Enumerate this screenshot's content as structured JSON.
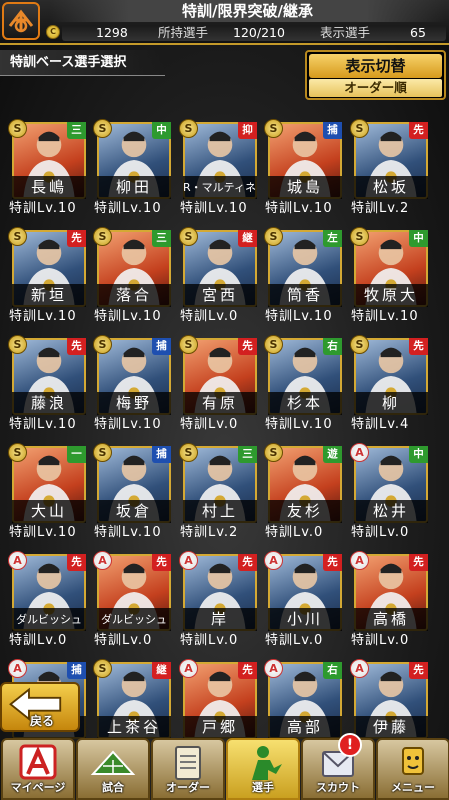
{
  "header": {
    "title": "特訓/限界突破/継承",
    "coin_value": "1298",
    "players_label": "所持選手",
    "players_value": "120/210",
    "display_label": "表示選手",
    "display_value": "65"
  },
  "subheader": {
    "title": "特訓ベース選手選択"
  },
  "display_toggle": {
    "label": "表示切替",
    "sort": "オーダー順"
  },
  "cards": [
    {
      "name": "長嶋",
      "pos": "三",
      "pos_color": "green",
      "emblem": "S",
      "level": "特訓Lv.10"
    },
    {
      "name": "柳田",
      "pos": "中",
      "pos_color": "green",
      "emblem": "S",
      "level": "特訓Lv.10"
    },
    {
      "name": "R・マルティネス",
      "pos": "抑",
      "pos_color": "red",
      "emblem": "S",
      "level": "特訓Lv.10"
    },
    {
      "name": "城島",
      "pos": "捕",
      "pos_color": "navy",
      "emblem": "S",
      "level": "特訓Lv.10"
    },
    {
      "name": "松坂",
      "pos": "先",
      "pos_color": "red",
      "emblem": "S",
      "level": "特訓Lv.2"
    },
    {
      "name": "新垣",
      "pos": "先",
      "pos_color": "red",
      "emblem": "S",
      "level": "特訓Lv.10"
    },
    {
      "name": "落合",
      "pos": "三",
      "pos_color": "green",
      "emblem": "S",
      "level": "特訓Lv.10"
    },
    {
      "name": "宮西",
      "pos": "継",
      "pos_color": "red",
      "emblem": "S",
      "level": "特訓Lv.0"
    },
    {
      "name": "筒香",
      "pos": "左",
      "pos_color": "green",
      "emblem": "S",
      "level": "特訓Lv.10"
    },
    {
      "name": "牧原大",
      "pos": "中",
      "pos_color": "green",
      "emblem": "S",
      "level": "特訓Lv.10"
    },
    {
      "name": "藤浪",
      "pos": "先",
      "pos_color": "red",
      "emblem": "S",
      "level": "特訓Lv.10"
    },
    {
      "name": "梅野",
      "pos": "捕",
      "pos_color": "navy",
      "emblem": "S",
      "level": "特訓Lv.10"
    },
    {
      "name": "有原",
      "pos": "先",
      "pos_color": "red",
      "emblem": "S",
      "level": "特訓Lv.0"
    },
    {
      "name": "杉本",
      "pos": "右",
      "pos_color": "green",
      "emblem": "S",
      "level": "特訓Lv.10"
    },
    {
      "name": "柳",
      "pos": "先",
      "pos_color": "red",
      "emblem": "S",
      "level": "特訓Lv.4"
    },
    {
      "name": "大山",
      "pos": "一",
      "pos_color": "green",
      "emblem": "S",
      "level": "特訓Lv.10"
    },
    {
      "name": "坂倉",
      "pos": "捕",
      "pos_color": "navy",
      "emblem": "S",
      "level": "特訓Lv.10"
    },
    {
      "name": "村上",
      "pos": "三",
      "pos_color": "green",
      "emblem": "S",
      "level": "特訓Lv.2"
    },
    {
      "name": "友杉",
      "pos": "遊",
      "pos_color": "green",
      "emblem": "S",
      "level": "特訓Lv.0"
    },
    {
      "name": "松井",
      "pos": "中",
      "pos_color": "green",
      "emblem": "A",
      "level": "特訓Lv.0"
    },
    {
      "name": "ダルビッシュ",
      "pos": "先",
      "pos_color": "red",
      "emblem": "A",
      "level": "特訓Lv.0"
    },
    {
      "name": "ダルビッシュ",
      "pos": "先",
      "pos_color": "red",
      "emblem": "A",
      "level": "特訓Lv.0"
    },
    {
      "name": "岸",
      "pos": "先",
      "pos_color": "red",
      "emblem": "A",
      "level": "特訓Lv.0"
    },
    {
      "name": "小川",
      "pos": "先",
      "pos_color": "red",
      "emblem": "A",
      "level": "特訓Lv.0"
    },
    {
      "name": "高橋",
      "pos": "先",
      "pos_color": "red",
      "emblem": "A",
      "level": "特訓Lv.0"
    },
    {
      "name": "",
      "pos": "捕",
      "pos_color": "navy",
      "emblem": "A",
      "level": ""
    },
    {
      "name": "上茶谷",
      "pos": "継",
      "pos_color": "red",
      "emblem": "S",
      "level": ""
    },
    {
      "name": "戸郷",
      "pos": "先",
      "pos_color": "red",
      "emblem": "A",
      "level": ""
    },
    {
      "name": "高部",
      "pos": "右",
      "pos_color": "green",
      "emblem": "A",
      "level": ""
    },
    {
      "name": "伊藤",
      "pos": "先",
      "pos_color": "red",
      "emblem": "A",
      "level": ""
    }
  ],
  "back_button": {
    "label": "戻る"
  },
  "tabs": [
    {
      "label": "マイページ",
      "icon": "a-logo-icon"
    },
    {
      "label": "試合",
      "icon": "baseball-field-icon"
    },
    {
      "label": "オーダー",
      "icon": "clipboard-icon"
    },
    {
      "label": "選手",
      "icon": "player-silhouette-icon"
    },
    {
      "label": "スカウト",
      "icon": "scout-envelope-icon"
    },
    {
      "label": "メニュー",
      "icon": "menu-character-icon"
    }
  ],
  "notification": {
    "label": "!"
  },
  "colors": {
    "gold": "#d4a934",
    "red_pos": "#d32020",
    "green_pos": "#2e9a2e",
    "navy_pos": "#1e4fb0"
  }
}
